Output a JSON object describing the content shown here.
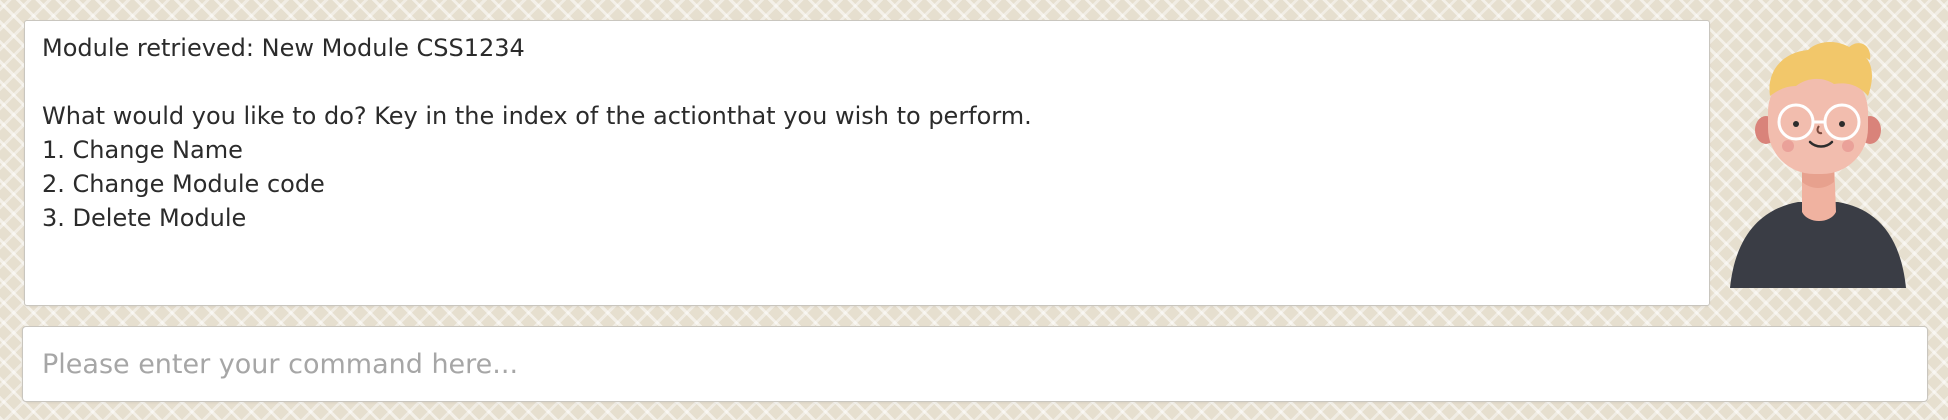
{
  "dialog": {
    "lines": [
      "Module retrieved: New Module CSS1234",
      "",
      "What would you like to do? Key in the index of the actionthat you wish to perform.",
      "1. Change Name",
      "2. Change Module code",
      "3. Delete Module"
    ]
  },
  "avatar": {
    "icon": "bot-avatar-icon",
    "hair_color": "#f2c76a",
    "skin_color": "#f2b8a8",
    "shirt_color": "#3a3d45"
  },
  "command": {
    "value": "",
    "placeholder": "Please enter your command here..."
  },
  "colors": {
    "background": "#e6dfcf",
    "panel": "#ffffff",
    "text": "#2b2b2b",
    "placeholder": "#a6a6a6"
  }
}
